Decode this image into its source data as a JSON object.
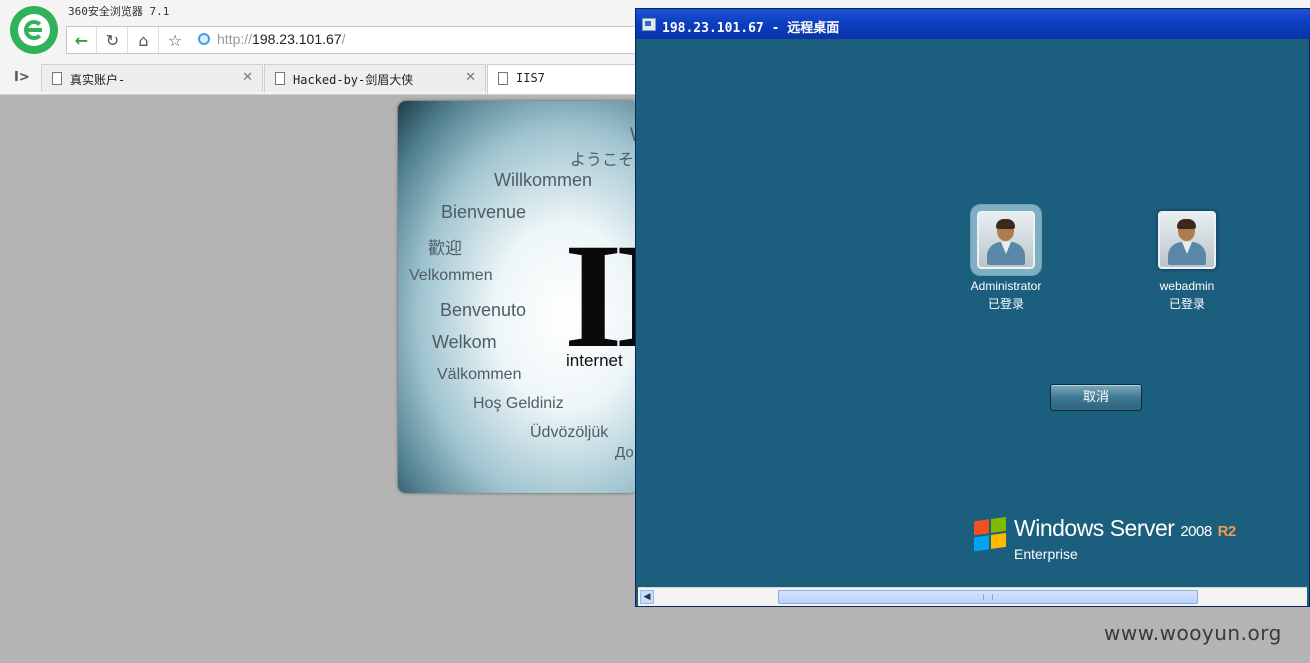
{
  "browser": {
    "title": "360安全浏览器 7.1",
    "url_protocol": "http://",
    "url_host": "198.23.101.67",
    "url_suffix": "/",
    "sidebar_toggle": "I>",
    "tabs": [
      {
        "label": "真实账户-",
        "active": false
      },
      {
        "label": "Hacked-by-剑眉大侠",
        "active": false
      },
      {
        "label": "IIS7",
        "active": true
      }
    ]
  },
  "iis_page": {
    "logo_text": "II",
    "tagline": "internet",
    "words": [
      "W",
      "ようこそ",
      "Willkommen",
      "Bienvenue",
      "歡迎",
      "Velkommen",
      "Benvenuto",
      "Welkom",
      "Välkommen",
      "Hoş Geldiniz",
      "Üdvözöljük",
      "До"
    ]
  },
  "rdp": {
    "title": "198.23.101.67 - 远程桌面",
    "users": [
      {
        "name": "Administrator",
        "status": "已登录",
        "selected": true
      },
      {
        "name": "webadmin",
        "status": "已登录",
        "selected": false
      }
    ],
    "cancel_label": "取消",
    "branding": {
      "product": "Windows Server",
      "version": "2008",
      "release": "R2",
      "edition": "Enterprise",
      "flag_colors": [
        "#f25022",
        "#7fba00",
        "#00a4ef",
        "#ffb900"
      ]
    }
  },
  "watermark": "www.wooyun.org"
}
